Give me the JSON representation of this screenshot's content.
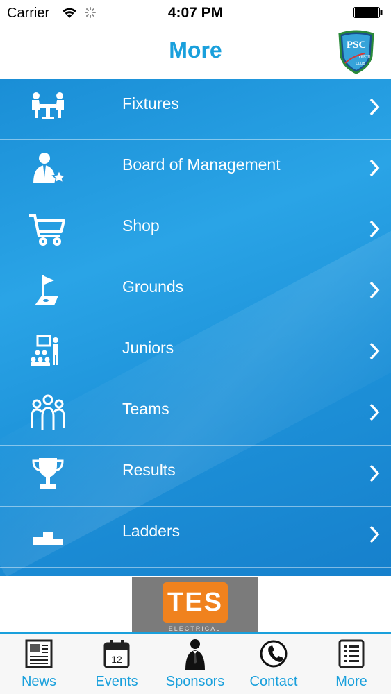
{
  "status_bar": {
    "carrier": "Carrier",
    "time": "4:07 PM"
  },
  "nav": {
    "title": "More",
    "logo_text_main": "PSC",
    "logo_text_side": "PERTH",
    "logo_text_bottom": "CLUB"
  },
  "menu": {
    "items": [
      {
        "label": "Fixtures",
        "icon": "fixtures-icon"
      },
      {
        "label": "Board of Management",
        "icon": "board-icon"
      },
      {
        "label": "Shop",
        "icon": "shopping-cart-icon"
      },
      {
        "label": "Grounds",
        "icon": "grounds-flag-icon"
      },
      {
        "label": "Juniors",
        "icon": "juniors-icon"
      },
      {
        "label": "Teams",
        "icon": "teams-icon"
      },
      {
        "label": "Results",
        "icon": "trophy-icon"
      },
      {
        "label": "Ladders",
        "icon": "podium-icon"
      }
    ]
  },
  "ad": {
    "logo_text": "TES",
    "sub_text": "ELECTRICAL"
  },
  "tabs": [
    {
      "label": "News",
      "icon": "newspaper-icon"
    },
    {
      "label": "Events",
      "icon": "calendar-icon",
      "icon_text": "12"
    },
    {
      "label": "Sponsors",
      "icon": "businessman-icon"
    },
    {
      "label": "Contact",
      "icon": "phone-icon"
    },
    {
      "label": "More",
      "icon": "list-icon"
    }
  ],
  "colors": {
    "accent": "#1aa0dc",
    "menu_bg": "#1e93da",
    "ad_orange": "#f0821e"
  }
}
